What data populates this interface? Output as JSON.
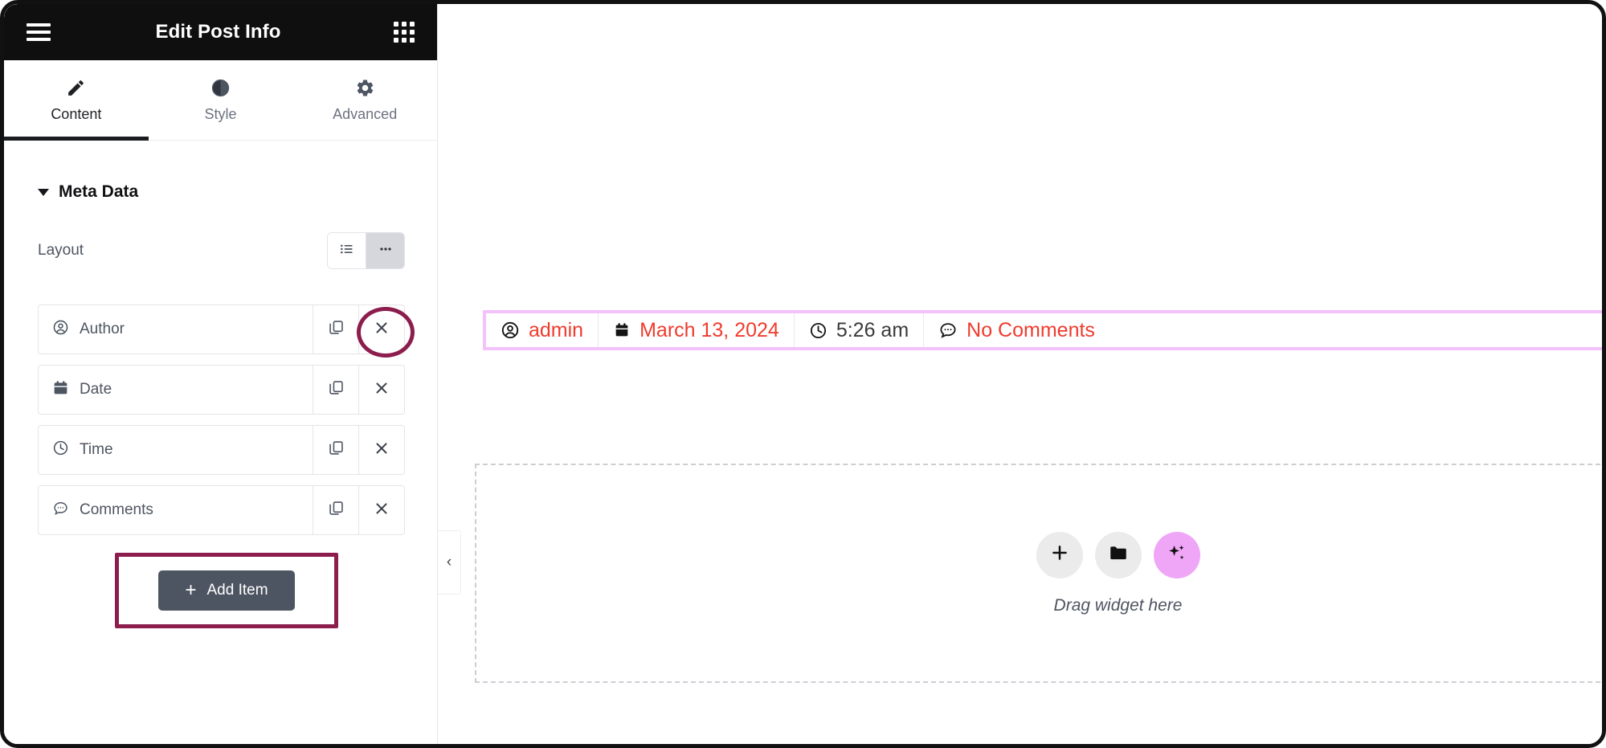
{
  "panel": {
    "title": "Edit Post Info",
    "menu_icon": "hamburger-menu-icon",
    "apps_icon": "grid-apps-icon",
    "tabs": [
      {
        "label": "Content",
        "icon": "pencil-icon",
        "active": true
      },
      {
        "label": "Style",
        "icon": "contrast-half-circle-icon",
        "active": false
      },
      {
        "label": "Advanced",
        "icon": "gear-icon",
        "active": false
      }
    ],
    "section": {
      "title": "Meta Data",
      "collapsed": false
    },
    "layout": {
      "label": "Layout",
      "options": [
        {
          "name": "list-layout",
          "icon": "list-icon",
          "selected": false
        },
        {
          "name": "inline-layout",
          "icon": "ellipsis-icon",
          "selected": true
        }
      ]
    },
    "repeater": {
      "items": [
        {
          "label": "Author",
          "icon": "user-circle-icon",
          "duplicate_icon": "copy-icon",
          "remove_icon": "close-x-icon",
          "highlighted": true
        },
        {
          "label": "Date",
          "icon": "calendar-icon",
          "duplicate_icon": "copy-icon",
          "remove_icon": "close-x-icon",
          "highlighted": false
        },
        {
          "label": "Time",
          "icon": "clock-icon",
          "duplicate_icon": "copy-icon",
          "remove_icon": "close-x-icon",
          "highlighted": false
        },
        {
          "label": "Comments",
          "icon": "comment-bubble-icon",
          "duplicate_icon": "copy-icon",
          "remove_icon": "close-x-icon",
          "highlighted": false
        }
      ],
      "add_item_label": "Add Item",
      "add_item_icon": "plus-icon"
    }
  },
  "canvas": {
    "collapse_icon": "chevron-left-icon",
    "meta_bar": {
      "items": [
        {
          "icon": "user-circle-icon",
          "text": "admin",
          "link": true
        },
        {
          "icon": "calendar-icon",
          "text": "March 13, 2024",
          "link": true
        },
        {
          "icon": "clock-icon",
          "text": "5:26 am",
          "link": false
        },
        {
          "icon": "comment-bubble-icon",
          "text": "No Comments",
          "link": true
        }
      ]
    },
    "drop_zone": {
      "label": "Drag widget here",
      "buttons": [
        {
          "name": "add-widget-button",
          "icon": "plus-icon"
        },
        {
          "name": "open-folder-button",
          "icon": "folder-icon"
        },
        {
          "name": "ai-button",
          "icon": "sparkles-icon"
        }
      ]
    }
  },
  "colors": {
    "panel_header_bg": "#0f0f10",
    "annotation": "#8c1d4d",
    "link_red": "#ef3b2d",
    "selection_pink": "#f3c2fb",
    "add_item_bg": "#4e5562",
    "ai_pink": "#f0a6f7"
  }
}
